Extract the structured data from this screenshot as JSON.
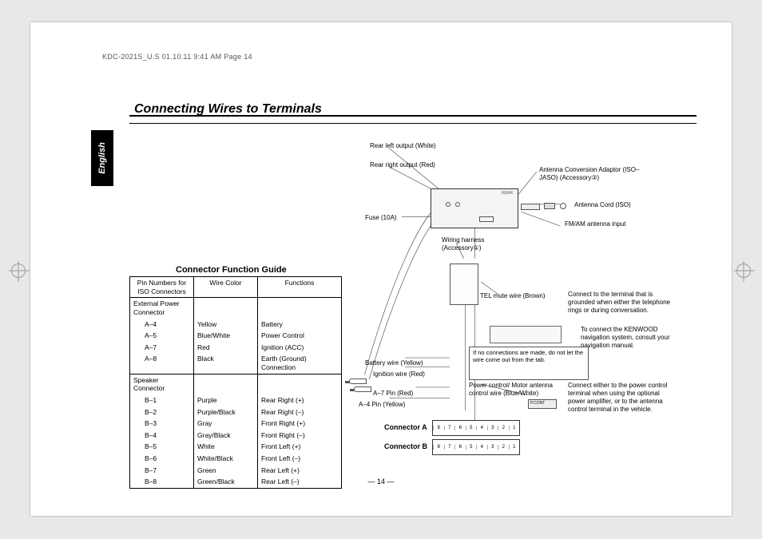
{
  "header": "KDC-2021S_U.S  01.10.11  9:41 AM  Page 14",
  "title": "Connecting Wires to Terminals",
  "language_tab": "English",
  "guide_title": "Connector Function Guide",
  "table": {
    "headers": {
      "pin": "Pin Numbers for ISO Connectors",
      "color": "Wire Color",
      "func": "Functions"
    },
    "groups": [
      {
        "heading": "External Power Connector",
        "rows": [
          {
            "pin": "A–4",
            "color": "Yellow",
            "func": "Battery"
          },
          {
            "pin": "A–5",
            "color": "Blue/White",
            "func": "Power Control"
          },
          {
            "pin": "A–7",
            "color": "Red",
            "func": "Ignition (ACC)"
          },
          {
            "pin": "A–8",
            "color": "Black",
            "func": "Earth (Ground) Connection"
          }
        ]
      },
      {
        "heading": "Speaker Connector",
        "rows": [
          {
            "pin": "B–1",
            "color": "Purple",
            "func": "Rear Right (+)"
          },
          {
            "pin": "B–2",
            "color": "Purple/Black",
            "func": "Rear Right (–)"
          },
          {
            "pin": "B–3",
            "color": "Gray",
            "func": "Front Right (+)"
          },
          {
            "pin": "B–4",
            "color": "Gray/Black",
            "func": "Front Right (–)"
          },
          {
            "pin": "B–5",
            "color": "White",
            "func": "Front Left (+)"
          },
          {
            "pin": "B–6",
            "color": "White/Black",
            "func": "Front Left (–)"
          },
          {
            "pin": "B–7",
            "color": "Green",
            "func": "Rear Left (+)"
          },
          {
            "pin": "B–8",
            "color": "Green/Black",
            "func": "Rear Left (–)"
          }
        ]
      }
    ]
  },
  "labels": {
    "rear_left": "Rear left output (White)",
    "rear_right": "Rear right output (Red)",
    "fuse": "Fuse (10A)",
    "antenna_adaptor": "Antenna Conversion Adaptor (ISO–JASO) (Accessory③)",
    "antenna_cord": "Antenna Cord (ISO)",
    "fmam": "FM/AM antenna input",
    "harness": "Wiring harness (Accessory①)",
    "tel_mute": "TEL mute wire (Brown)",
    "tel_mute_note": "Connect to the terminal that is grounded when either the telephone rings or during conversation.",
    "nav_note": "To connect the KENWOOD navigation system, consult your navigation manual.",
    "no_conn": "If no connections are made, do not let the wire come out from the tab.",
    "battery": "Battery wire (Yellow)",
    "ignition": "Ignition wire (Red)",
    "a7": "A–7 Pin (Red)",
    "a4": "A–4 Pin (Yellow)",
    "pc_wire": "Power control/ Motor antenna control wire (Blue/White)",
    "pc_note": "Connect either to the power control terminal when using the optional power amplifier, or to the antenna control terminal in the vehicle.",
    "conn_a": "Connector A",
    "conn_b": "Connector B"
  },
  "connectorA": [
    "8",
    "7",
    "6",
    "5",
    "4",
    "3",
    "2",
    "1"
  ],
  "connectorB": [
    "8",
    "7",
    "6",
    "5",
    "4",
    "3",
    "2",
    "1"
  ],
  "page_number": "— 14 —"
}
